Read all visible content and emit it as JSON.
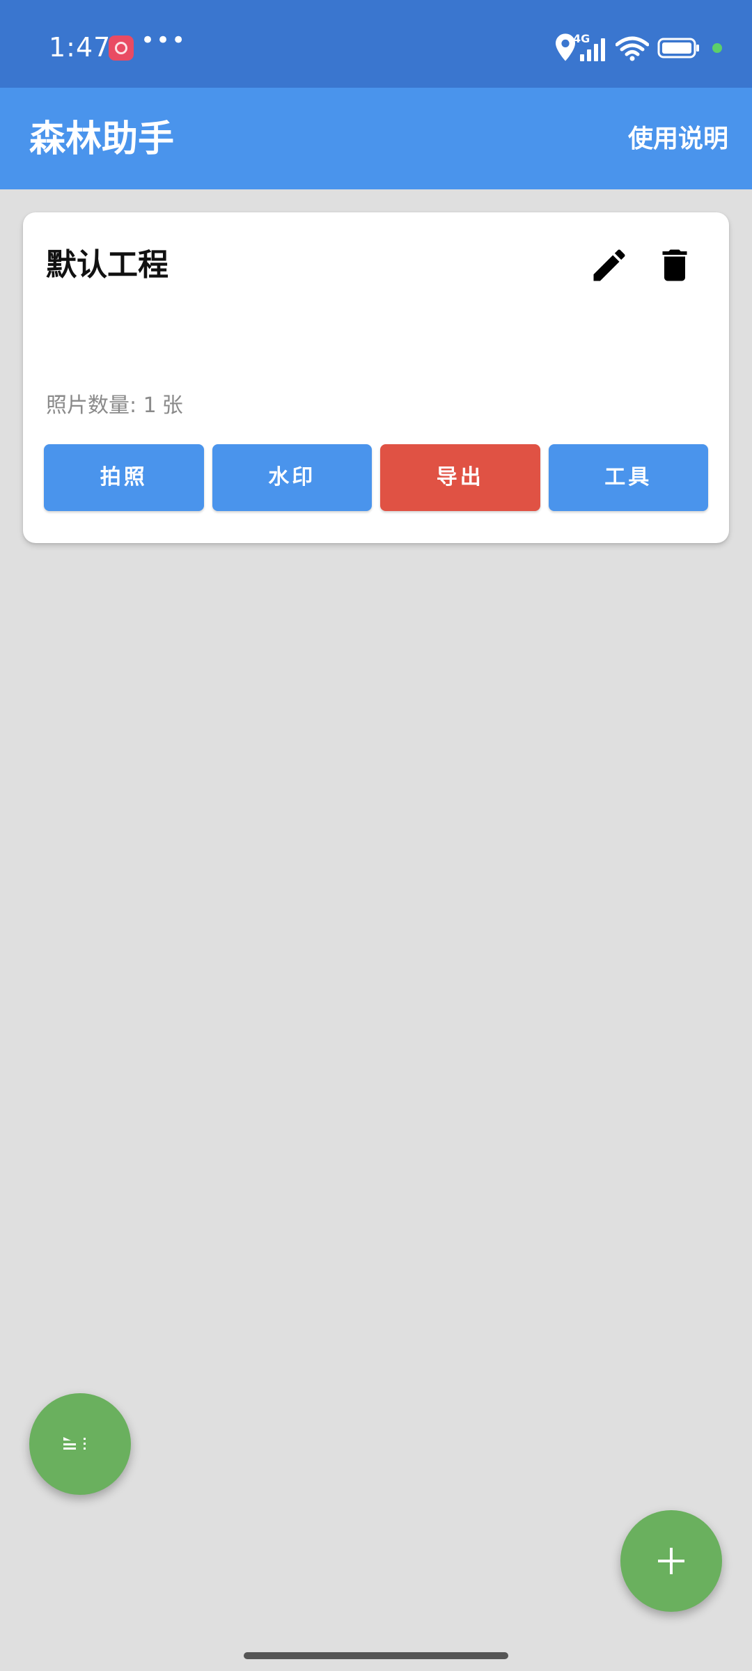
{
  "status_bar": {
    "time": "1:47",
    "network_label": "4G",
    "icons": [
      "app-notification-icon",
      "more-dots-icon",
      "location-icon",
      "signal-icon",
      "wifi-icon",
      "battery-icon",
      "privacy-dot-icon"
    ],
    "privacy_dot_color": "#5ccf6a"
  },
  "app_bar": {
    "title": "森林助手",
    "help_label": "使用说明",
    "background_color": "#4a94ec"
  },
  "project_card": {
    "name": "默认工程",
    "photo_count_label": "照片数量: 1",
    "photo_count_unit": "张",
    "edit_icon": "pencil-icon",
    "delete_icon": "trash-icon",
    "actions": [
      {
        "label": "拍照",
        "color": "#4a94ec"
      },
      {
        "label": "水印",
        "color": "#4a94ec"
      },
      {
        "label": "导出",
        "color": "#e05244"
      },
      {
        "label": "工具",
        "color": "#4a94ec"
      }
    ]
  },
  "fabs": {
    "left_icon": "sort-icon",
    "right_icon": "plus-icon",
    "color": "#6ab05e"
  }
}
